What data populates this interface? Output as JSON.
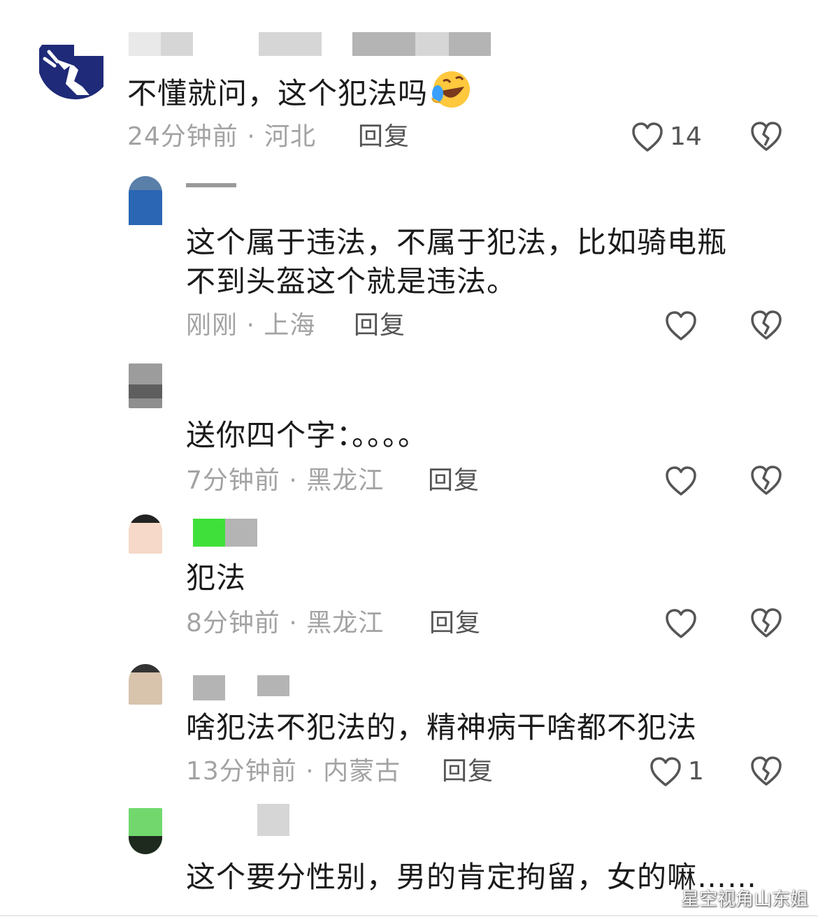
{
  "comments": [
    {
      "text": "不懂就问，这个犯法吗",
      "time": "24分钟前",
      "location": "河北",
      "reply_label": "回复",
      "likes": "14"
    },
    {
      "text_line1": "这个属于违法，不属于犯法，比如骑电瓶",
      "text_line2": "不到头盔这个就是违法。",
      "time": "刚刚",
      "location": "上海",
      "reply_label": "回复",
      "likes": ""
    },
    {
      "text": "送你四个字：。。。。",
      "time": "7分钟前",
      "location": "黑龙江",
      "reply_label": "回复",
      "likes": ""
    },
    {
      "text": "犯法",
      "time": "8分钟前",
      "location": "黑龙江",
      "reply_label": "回复",
      "likes": ""
    },
    {
      "text": "啥犯法不犯法的，精神病干啥都不犯法",
      "time": "13分钟前",
      "location": "内蒙古",
      "reply_label": "回复",
      "likes": "1"
    },
    {
      "text": "这个要分性别，男的肯定拘留，女的嘛……",
      "time": "",
      "location": "",
      "reply_label": "",
      "likes": ""
    }
  ],
  "separator": " · ",
  "watermark": "星空视角山东姐",
  "colors": {
    "text": "#1a1a1a",
    "meta": "#a3a3a3",
    "reply": "#555555",
    "icon": "#555555",
    "blur": "#d6d6d6"
  },
  "icons": [
    "heart-outline-icon",
    "broken-heart-icon",
    "laughing-emoji-icon"
  ]
}
